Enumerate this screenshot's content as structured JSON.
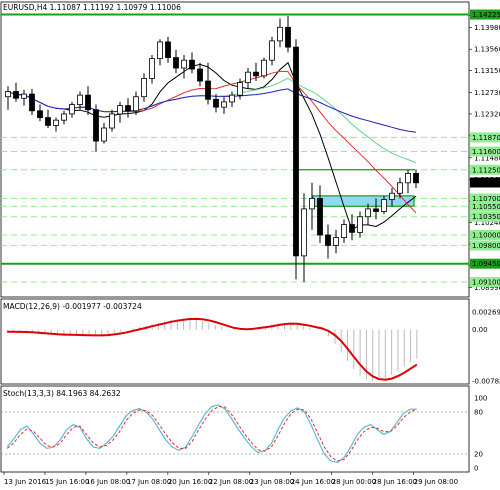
{
  "main_title": "EURUSD,H4  1.11087 1.11192 1.10979 1.11006",
  "macd_title": "MACD(12,26,9) -0.001977 -0.003724",
  "stoch_title": "Stoch(13,3,3) 84.1963 84.2632",
  "price_axis": {
    "ticks": [
      "1.14210",
      "1.13980",
      "1.13560",
      "1.13150",
      "1.12730",
      "1.12320",
      "1.11900",
      "1.11480",
      "1.11065",
      "1.10650",
      "1.10240",
      "1.09820",
      "1.09410",
      "1.08990"
    ],
    "highlighted": [
      {
        "label": "1.14225",
        "color": "#1a9f1a"
      },
      {
        "label": "1.11870",
        "color": "#90ee90"
      },
      {
        "label": "1.11600",
        "color": "#90ee90"
      },
      {
        "label": "1.11250",
        "color": "#90ee90"
      },
      {
        "label": "1.11006",
        "color": "#000000",
        "current": true
      },
      {
        "label": "1.10700",
        "color": "#90ee90"
      },
      {
        "label": "1.10550",
        "color": "#90ee90"
      },
      {
        "label": "1.10350",
        "color": "#90ee90"
      },
      {
        "label": "1.10000",
        "color": "#90ee90"
      },
      {
        "label": "1.09800",
        "color": "#90ee90"
      },
      {
        "label": "1.09450",
        "color": "#1a9f1a"
      },
      {
        "label": "1.09100",
        "color": "#90ee90"
      }
    ]
  },
  "macd_axis": {
    "ticks": [
      "0.002695",
      "0.00",
      "-0.00782"
    ]
  },
  "stoch_axis": {
    "ticks": [
      "100",
      "80",
      "20",
      "0"
    ]
  },
  "time_axis": {
    "labels": [
      "13 Jun 2016",
      "15 Jun 16:00",
      "16 Jun 08:00",
      "17 Jun 08:00",
      "20 Jun 16:00",
      "22 Jun 08:00",
      "23 Jun 08:00",
      "24 Jun 16:00",
      "28 Jun 00:00",
      "28 Jun 16:00",
      "29 Jun 08:00"
    ]
  },
  "colors": {
    "bull": "#ffffff",
    "bear": "#000000",
    "level_strong": "#1a9f1a",
    "level_weak": "#90ee90",
    "zone": "#8fd9f0",
    "macd_line": "#e00000",
    "signal_dots": "#e00000",
    "stoch_main": "#5fb8d8",
    "stoch_signal": "#e03030",
    "ma_black": "#000000",
    "ma_red": "#e03030",
    "ma_green": "#5fd38b",
    "ma_blue": "#2020c0"
  },
  "chart_data": {
    "type": "candlestick",
    "symbol": "EURUSD",
    "timeframe": "H4",
    "ohlc": {
      "open": 1.11087,
      "high": 1.11192,
      "low": 1.10979,
      "close": 1.11006
    },
    "ylim": [
      1.0885,
      1.1435
    ],
    "candles": [
      [
        1.1265,
        1.1285,
        1.124,
        1.1275
      ],
      [
        1.1275,
        1.1292,
        1.1255,
        1.1262
      ],
      [
        1.1262,
        1.1278,
        1.1248,
        1.127
      ],
      [
        1.127,
        1.128,
        1.123,
        1.1238
      ],
      [
        1.1238,
        1.125,
        1.1218,
        1.1225
      ],
      [
        1.1225,
        1.124,
        1.1205,
        1.121
      ],
      [
        1.121,
        1.1225,
        1.1198,
        1.122
      ],
      [
        1.122,
        1.1238,
        1.1212,
        1.1232
      ],
      [
        1.1232,
        1.1255,
        1.1225,
        1.125
      ],
      [
        1.125,
        1.1275,
        1.124,
        1.1268
      ],
      [
        1.1268,
        1.1285,
        1.123,
        1.124
      ],
      [
        1.124,
        1.125,
        1.116,
        1.118
      ],
      [
        1.118,
        1.1215,
        1.1175,
        1.1205
      ],
      [
        1.1205,
        1.124,
        1.1198,
        1.1232
      ],
      [
        1.1232,
        1.1255,
        1.1215,
        1.1248
      ],
      [
        1.1248,
        1.1262,
        1.1225,
        1.1238
      ],
      [
        1.1238,
        1.1275,
        1.123,
        1.1265
      ],
      [
        1.1265,
        1.131,
        1.1255,
        1.13
      ],
      [
        1.13,
        1.1345,
        1.129,
        1.1338
      ],
      [
        1.1338,
        1.1375,
        1.1325,
        1.137
      ],
      [
        1.137,
        1.138,
        1.133,
        1.134
      ],
      [
        1.134,
        1.1355,
        1.131,
        1.132
      ],
      [
        1.132,
        1.1345,
        1.13,
        1.1335
      ],
      [
        1.1335,
        1.135,
        1.131,
        1.1318
      ],
      [
        1.1318,
        1.133,
        1.1285,
        1.1295
      ],
      [
        1.1295,
        1.133,
        1.125,
        1.126
      ],
      [
        1.126,
        1.127,
        1.1235,
        1.1245
      ],
      [
        1.1245,
        1.1265,
        1.1232,
        1.1255
      ],
      [
        1.1255,
        1.1275,
        1.1245,
        1.1268
      ],
      [
        1.1268,
        1.13,
        1.126,
        1.1292
      ],
      [
        1.1292,
        1.132,
        1.128,
        1.1312
      ],
      [
        1.1312,
        1.133,
        1.1295,
        1.1305
      ],
      [
        1.1305,
        1.134,
        1.13,
        1.1335
      ],
      [
        1.1335,
        1.138,
        1.1325,
        1.1372
      ],
      [
        1.1372,
        1.1415,
        1.136,
        1.1398
      ],
      [
        1.1398,
        1.142,
        1.135,
        1.136
      ],
      [
        1.136,
        1.1375,
        1.0915,
        1.096
      ],
      [
        1.096,
        1.108,
        1.091,
        1.105
      ],
      [
        1.105,
        1.11,
        1.101,
        1.107
      ],
      [
        1.107,
        1.1095,
        1.0985,
        1.1
      ],
      [
        1.1,
        1.102,
        1.0955,
        1.098
      ],
      [
        1.098,
        1.101,
        1.0965,
        1.0995
      ],
      [
        1.0995,
        1.103,
        1.0985,
        1.102
      ],
      [
        1.102,
        1.104,
        1.099,
        1.1005
      ],
      [
        1.1005,
        1.1045,
        1.0995,
        1.1035
      ],
      [
        1.1035,
        1.106,
        1.102,
        1.105
      ],
      [
        1.105,
        1.107,
        1.103,
        1.1045
      ],
      [
        1.1045,
        1.1075,
        1.104,
        1.1068
      ],
      [
        1.1068,
        1.109,
        1.1055,
        1.108
      ],
      [
        1.108,
        1.111,
        1.107,
        1.11
      ],
      [
        1.11,
        1.1125,
        1.108,
        1.1118
      ],
      [
        1.1118,
        1.1125,
        1.109,
        1.11
      ]
    ],
    "zone": [
      1.1055,
      1.1075
    ],
    "macd_values": [
      -0.0003,
      -0.0003,
      -0.0004,
      -0.0004,
      -0.0005,
      -0.0006,
      -0.0007,
      -0.0007,
      -0.0008,
      -0.0008,
      -0.0008,
      -0.0008,
      -0.0009,
      -0.0009,
      -0.0009,
      -0.0008,
      -0.0007,
      -0.0005,
      -0.0003,
      -0.0001,
      0.0002,
      0.0004,
      0.0006,
      0.0009,
      0.0011,
      0.0013,
      0.0015,
      0.0016,
      0.0017,
      0.0017,
      0.0016,
      0.0013,
      0.0011,
      0.0007,
      0.0004,
      0.0001,
      -0.0001,
      0.0001,
      0.0002,
      0.0003,
      0.0004,
      0.0006,
      0.0008,
      0.001,
      0.001,
      0.0009,
      0.0007,
      0.0005,
      0.0003,
      0.0001,
      -0.0002,
      -0.001,
      -0.0022,
      -0.0035,
      -0.0048,
      -0.006,
      -0.007,
      -0.0076,
      -0.0078,
      -0.0077,
      -0.0074,
      -0.0069,
      -0.0063,
      -0.0056,
      -0.005,
      -0.0044
    ],
    "stoch_main": [
      30,
      42,
      55,
      60,
      48,
      35,
      28,
      30,
      40,
      55,
      62,
      58,
      42,
      30,
      28,
      35,
      45,
      60,
      75,
      82,
      85,
      80,
      70,
      55,
      40,
      30,
      25,
      30,
      45,
      62,
      78,
      88,
      90,
      84,
      70,
      55,
      42,
      30,
      22,
      25,
      35,
      55,
      72,
      82,
      86,
      80,
      62,
      40,
      20,
      10,
      8,
      15,
      30,
      48,
      58,
      62,
      55,
      48,
      52,
      65,
      78,
      84,
      84
    ],
    "stoch_signal": [
      28,
      36,
      48,
      56,
      52,
      42,
      32,
      30,
      35,
      48,
      58,
      60,
      48,
      36,
      30,
      32,
      40,
      52,
      68,
      78,
      83,
      82,
      75,
      62,
      48,
      36,
      28,
      28,
      38,
      55,
      70,
      82,
      88,
      87,
      76,
      62,
      48,
      36,
      26,
      24,
      30,
      46,
      64,
      78,
      84,
      83,
      70,
      50,
      30,
      16,
      10,
      12,
      24,
      40,
      52,
      58,
      57,
      52,
      52,
      60,
      72,
      80,
      84
    ]
  }
}
